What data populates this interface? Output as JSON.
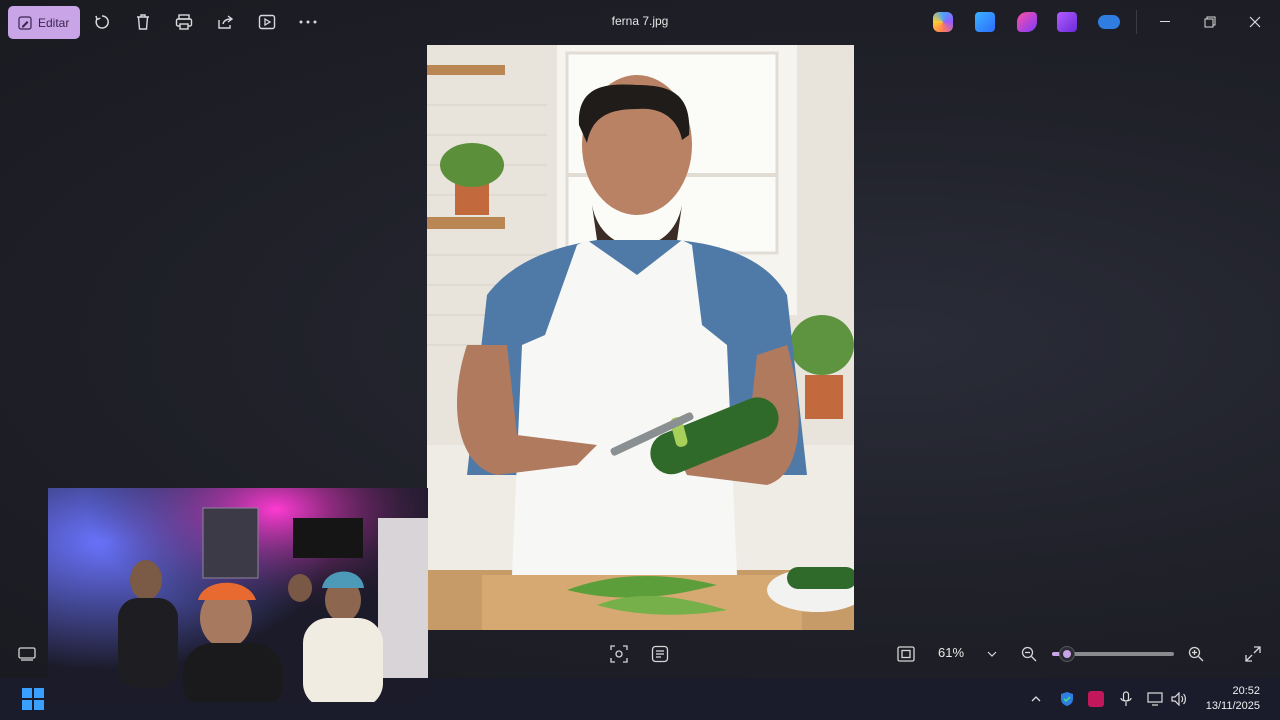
{
  "titlebar": {
    "edit_label": "Editar",
    "filename": "ferna 7.jpg"
  },
  "toolbar_icons": [
    "rotate-icon",
    "delete-icon",
    "print-icon",
    "share-icon",
    "slideshow-icon",
    "more-icon"
  ],
  "right_app_icons": [
    "copilot-icon",
    "designer-icon",
    "clipchamp-icon",
    "video-editor-icon",
    "onedrive-icon"
  ],
  "bottom": {
    "zoom_label": "61%",
    "zoom_level": 0.12
  },
  "taskbar": {
    "time": "20:52",
    "date": "13/11/2025"
  },
  "colors": {
    "accent": "#c9a4e6",
    "background": "#1f2028",
    "taskbar": "#1a1c2b"
  }
}
